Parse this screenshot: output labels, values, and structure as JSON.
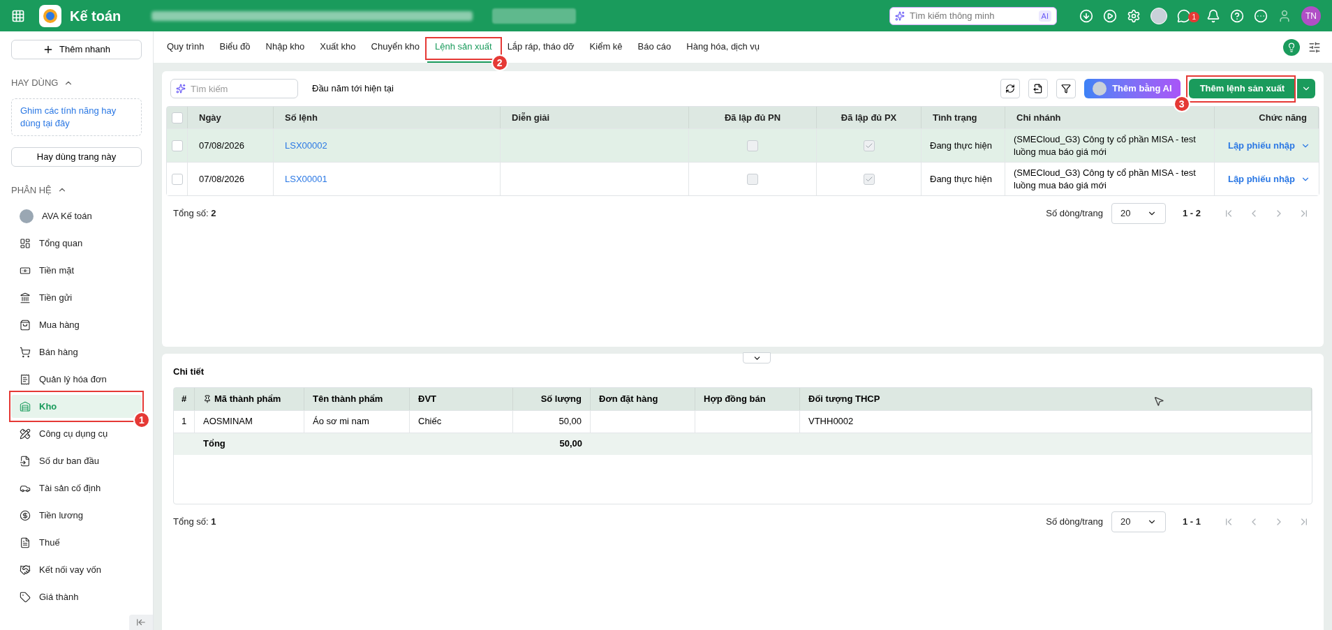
{
  "topbar": {
    "app_title": "Kế toán",
    "search_placeholder": "Tìm kiếm thông minh",
    "ai_badge": "AI",
    "notification_count": "1",
    "avatar_initials": "TN"
  },
  "sidebar": {
    "quick_add": "Thêm nhanh",
    "favorites": {
      "title": "HAY DÙNG",
      "expanded": true,
      "hint": "Ghim các tính năng hay dùng tại đây",
      "button": "Hay dùng trang này"
    },
    "modules": {
      "title": "PHÂN HỆ",
      "expanded": true,
      "items": [
        {
          "label": "AVA Kế toán",
          "selected": false
        },
        {
          "label": "Tổng quan",
          "selected": false
        },
        {
          "label": "Tiền mặt",
          "selected": false
        },
        {
          "label": "Tiền gửi",
          "selected": false
        },
        {
          "label": "Mua hàng",
          "selected": false
        },
        {
          "label": "Bán hàng",
          "selected": false
        },
        {
          "label": "Quản lý hóa đơn",
          "selected": false
        },
        {
          "label": "Kho",
          "selected": true,
          "annotation": "1"
        },
        {
          "label": "Công cụ dụng cụ",
          "selected": false
        },
        {
          "label": "Số dư ban đầu",
          "selected": false
        },
        {
          "label": "Tài sản cố định",
          "selected": false
        },
        {
          "label": "Tiền lương",
          "selected": false
        },
        {
          "label": "Thuế",
          "selected": false
        },
        {
          "label": "Kết nối vay vốn",
          "selected": false
        },
        {
          "label": "Giá thành",
          "selected": false
        }
      ]
    }
  },
  "tabs": [
    {
      "label": "Quy trình",
      "selected": false
    },
    {
      "label": "Biểu đồ",
      "selected": false
    },
    {
      "label": "Nhập kho",
      "selected": false
    },
    {
      "label": "Xuất kho",
      "selected": false
    },
    {
      "label": "Chuyển kho",
      "selected": false
    },
    {
      "label": "Lệnh sản xuất",
      "selected": true,
      "annotation": "2"
    },
    {
      "label": "Lắp ráp, tháo dỡ",
      "selected": false
    },
    {
      "label": "Kiểm kê",
      "selected": false
    },
    {
      "label": "Báo cáo",
      "selected": false
    },
    {
      "label": "Hàng hóa, dịch vụ",
      "selected": false
    }
  ],
  "toolbar": {
    "search_placeholder": "Tìm kiếm",
    "period": "Đầu năm tới hiện tại",
    "ai_button": "Thêm bằng AI",
    "add_button": {
      "label": "Thêm lệnh sản xuất",
      "annotation": "3"
    }
  },
  "orders": {
    "select_all_checked": false,
    "columns": [
      "Ngày",
      "Số lệnh",
      "Diễn giải",
      "Đã lập đủ PN",
      "Đã lập đủ PX",
      "Tình trạng",
      "Chi nhánh",
      "Chức năng"
    ],
    "rows": [
      {
        "checked": false,
        "selected": true,
        "date": "07/08/2026",
        "number": "LSX00002",
        "pn_done": false,
        "px_done": true,
        "status": "Đang thực hiện",
        "branch": "(SMECloud_G3) Công ty cổ phần MISA - test luồng mua báo giá mới",
        "action": "Lập phiếu nhập"
      },
      {
        "checked": false,
        "selected": false,
        "date": "07/08/2026",
        "number": "LSX00001",
        "pn_done": false,
        "px_done": true,
        "status": "Đang thực hiện",
        "branch": "(SMECloud_G3) Công ty cổ phần MISA - test luồng mua báo giá mới",
        "action": "Lập phiếu nhập"
      }
    ],
    "footer": {
      "total_label": "Tổng số:",
      "total": "2",
      "page_size_label": "Số dòng/trang",
      "page_size": "20",
      "range": "1 - 2"
    }
  },
  "detail": {
    "title": "Chi tiết",
    "columns": [
      "#",
      "Mã thành phẩm",
      "Tên thành phẩm",
      "ĐVT",
      "Số lượng",
      "Đơn đặt hàng",
      "Hợp đồng bán",
      "Đối tượng THCP"
    ],
    "rows": [
      {
        "index": "1",
        "code": "AOSMINAM",
        "name": "Áo sơ mi nam",
        "unit": "Chiếc",
        "quantity": "50,00",
        "cost_object": "VTHH0002"
      }
    ],
    "total_row": {
      "label": "Tổng",
      "quantity": "50,00"
    },
    "footer": {
      "total_label": "Tổng số:",
      "total": "1",
      "page_size_label": "Số dòng/trang",
      "page_size": "20",
      "range": "1 - 1"
    }
  }
}
